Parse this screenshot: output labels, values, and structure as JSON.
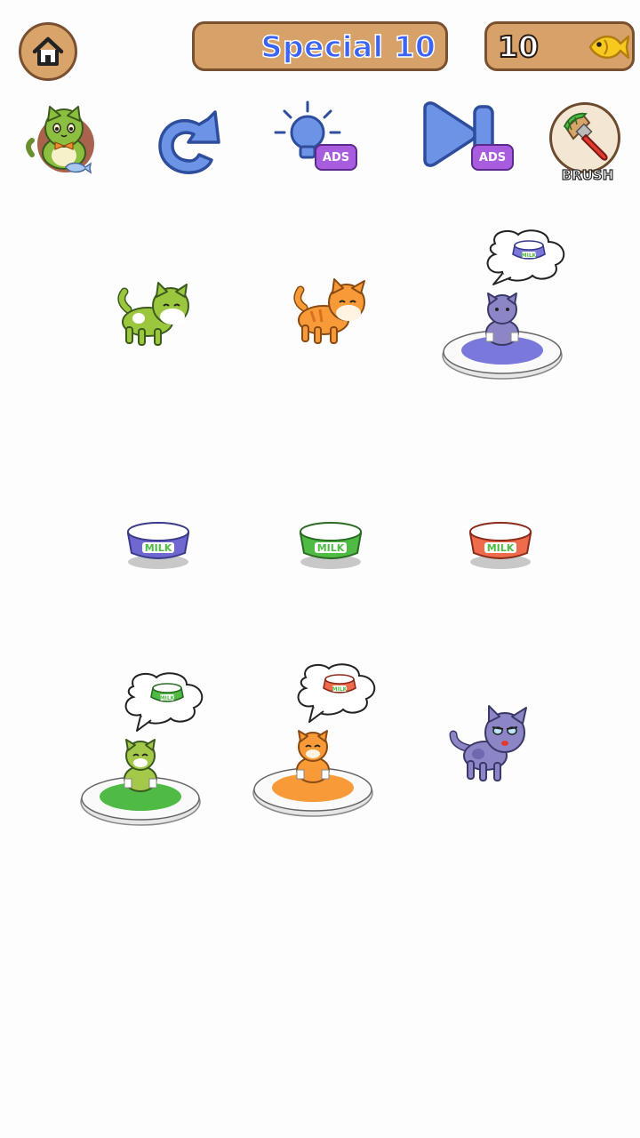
{
  "header": {
    "level_label": "Special 10",
    "fish_count": "10"
  },
  "toolbar": {
    "hint_ads_label": "ADS",
    "skip_ads_label": "ADS",
    "brush_label": "BRUSH"
  },
  "bowl_label": "MILK",
  "colors": {
    "purple": "#7b78dc",
    "green": "#4fbb45",
    "orange": "#f79a37",
    "red": "#ee6b4c",
    "wood": "#d6a26a",
    "wood_border": "#7a5030",
    "level_text": "#3b63f5",
    "ads_purple": "#a85ddf"
  }
}
